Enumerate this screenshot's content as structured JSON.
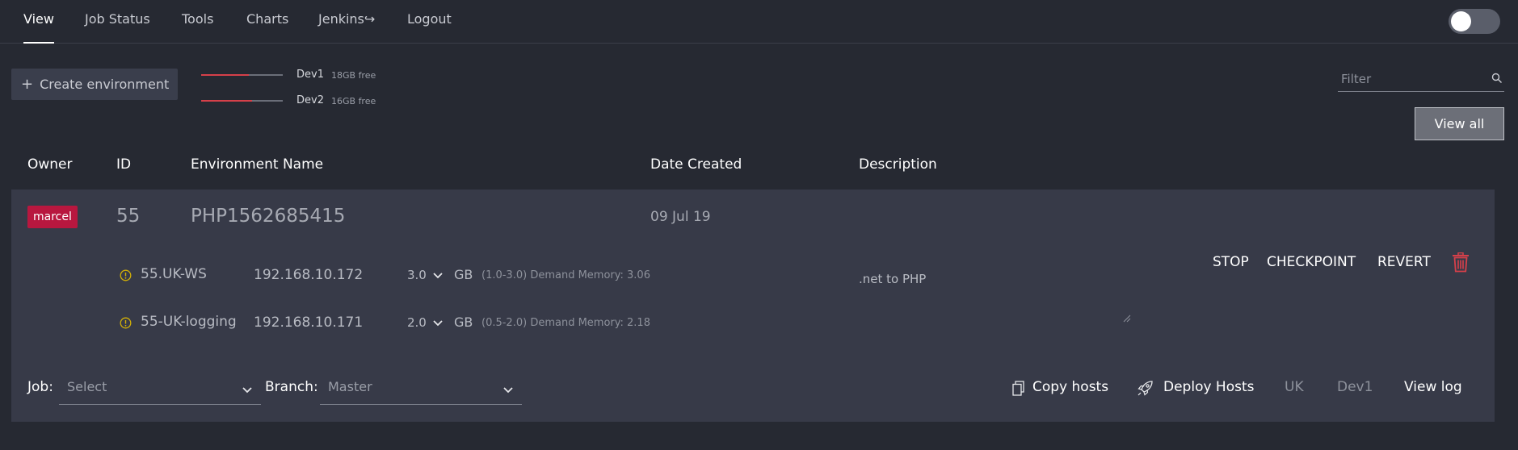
{
  "nav": {
    "items": [
      {
        "label": "View",
        "active": true
      },
      {
        "label": "Job Status"
      },
      {
        "label": "Tools"
      },
      {
        "label": "Charts"
      },
      {
        "label": "Jenkins↪"
      },
      {
        "label": "Logout"
      }
    ],
    "theme_toggle_on": false
  },
  "toolbar": {
    "create_label": "Create environment",
    "memory": [
      {
        "name": "Dev1",
        "free": "18GB free",
        "used_fraction": 0.58
      },
      {
        "name": "Dev2",
        "free": "16GB free",
        "used_fraction": 0.62
      }
    ],
    "filter_placeholder": "Filter",
    "view_all_label": "View all"
  },
  "table": {
    "headers": [
      "Owner",
      "ID",
      "Environment Name",
      "Date Created",
      "Description"
    ]
  },
  "environment": {
    "owner": "marcel",
    "id": "55",
    "name": "PHP1562685415",
    "date_created": "09 Jul 19",
    "description": ".net to PHP",
    "hosts": [
      {
        "name": "55.UK-WS",
        "ip": "192.168.10.172",
        "memory": "3.0",
        "unit": "GB",
        "demand": "(1.0-3.0) Demand Memory: 3.06"
      },
      {
        "name": "55-UK-logging",
        "ip": "192.168.10.171",
        "memory": "2.0",
        "unit": "GB",
        "demand": "(0.5-2.0) Demand Memory: 2.18"
      }
    ],
    "actions": {
      "stop": "STOP",
      "checkpoint": "CHECKPOINT",
      "revert": "REVERT"
    },
    "job_label": "Job:",
    "job_value": "Select",
    "branch_label": "Branch:",
    "branch_value": "Master",
    "copy_hosts": "Copy hosts",
    "deploy_hosts": "Deploy Hosts",
    "region": "UK",
    "server": "Dev1",
    "view_log": "View log"
  },
  "colors": {
    "background": "#262932",
    "card": "#373a48",
    "owner_badge": "#b8173f",
    "warning": "#d4b106",
    "danger": "#d6404a"
  }
}
